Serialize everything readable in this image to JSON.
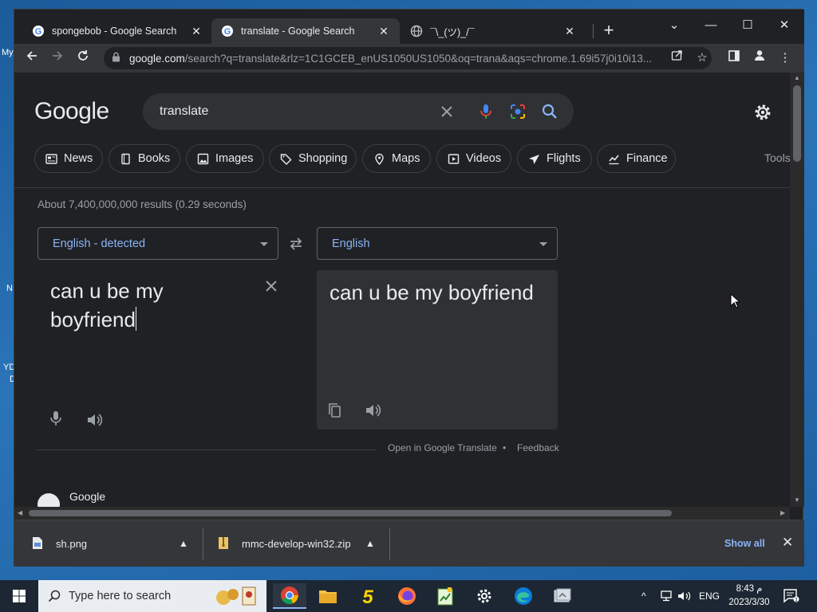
{
  "desktop": {
    "fragments": [
      "My",
      "N",
      "YD",
      "D"
    ]
  },
  "browser": {
    "tabs": [
      {
        "title": "spongebob - Google Search",
        "active": false
      },
      {
        "title": "translate - Google Search",
        "active": true
      },
      {
        "title": "¯\\_(ツ)_/¯",
        "active": false
      }
    ],
    "new_tab": "+",
    "window_controls": {
      "tab_search": "⌄",
      "minimize": "—",
      "maximize": "☐",
      "close": "✕"
    },
    "address": {
      "host": "google.com",
      "path": "/search?q=translate&rlz=1C1GCEB_enUS1050US1050&oq=trana&aqs=chrome.1.69i57j0i10i13..."
    }
  },
  "search": {
    "logo": "Google",
    "query": "translate",
    "chips": [
      "News",
      "Books",
      "Images",
      "Shopping",
      "Maps",
      "Videos",
      "Flights",
      "Finance"
    ],
    "tools": "Tools",
    "results_stats": "About 7,400,000,000 results (0.29 seconds)"
  },
  "translate": {
    "source_lang": "English - detected",
    "target_lang": "English",
    "source_text": "can u be my boyfriend",
    "target_text": "can u be my boyfriend",
    "open_link": "Open in Google Translate",
    "dot": "•",
    "feedback": "Feedback"
  },
  "next_result": {
    "site": "Google"
  },
  "downloads": {
    "items": [
      {
        "name": "sh.png"
      },
      {
        "name": "mmc-develop-win32.zip"
      }
    ],
    "show_all": "Show all",
    "close": "✕"
  },
  "taskbar": {
    "search_placeholder": "Type here to search",
    "tray": {
      "caret": "^",
      "lang": "ENG"
    },
    "clock": {
      "time": "8:43 م",
      "date": "2023/3/30"
    }
  },
  "colors": {
    "page_bg": "#202124",
    "link": "#8ab4f8",
    "accent_blue": "#4285f4"
  }
}
